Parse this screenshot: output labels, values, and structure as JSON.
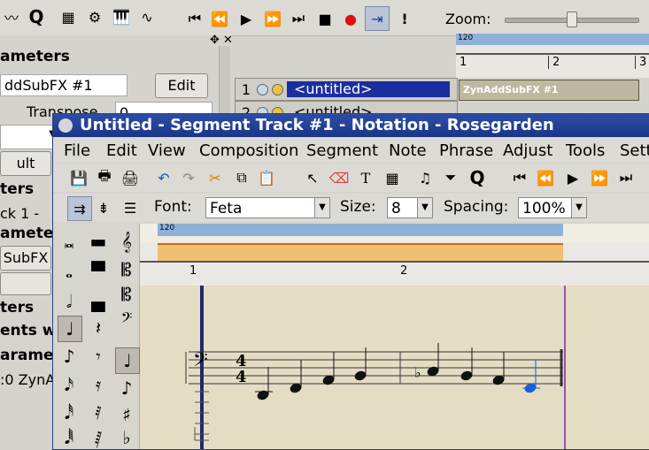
{
  "main_toolbar": {
    "zoom_label": "Zoom:",
    "quantize_glyph": "Q",
    "accent": "#7a8aa5"
  },
  "param_panel": {
    "title1": "ameters",
    "instrument_value": "ddSubFX #1",
    "edit_button": "Edit",
    "transpose_label": "Transpose",
    "transpose_value": "0",
    "ult_label": "ult",
    "title2": "ters",
    "ck_label": "ck 1 -",
    "title3": "ameter",
    "subfx_value": "SubFX",
    "title4": "ters",
    "ents_label": "ents w",
    "title5": "arameter",
    "zyn_label": ":0 ZynA"
  },
  "tracks": [
    {
      "num": "1",
      "label": "<untitled>",
      "selected": true
    },
    {
      "num": "2",
      "label": "<untitled>",
      "selected": false
    }
  ],
  "segment_canvas": {
    "tempo": "120",
    "bars": [
      "1",
      "2",
      "3"
    ],
    "segment_label": "ZynAddSubFX #1"
  },
  "notation": {
    "title": "Untitled - Segment Track #1 - Notation - Rosegarden",
    "menus": [
      "File",
      "Edit",
      "View",
      "Composition",
      "Segment",
      "Note",
      "Phrase",
      "Adjust",
      "Tools",
      "Setti"
    ],
    "font_label": "Font:",
    "font_value": "Feta",
    "size_label": "Size:",
    "size_value": "8",
    "spacing_label": "Spacing:",
    "spacing_value": "100%",
    "tempo": "120",
    "bars": [
      "1",
      "2"
    ],
    "time_sig_top": "4",
    "time_sig_bottom": "4",
    "note_color": "#1a5fd6",
    "cursor_color": "#9a4fb0"
  }
}
